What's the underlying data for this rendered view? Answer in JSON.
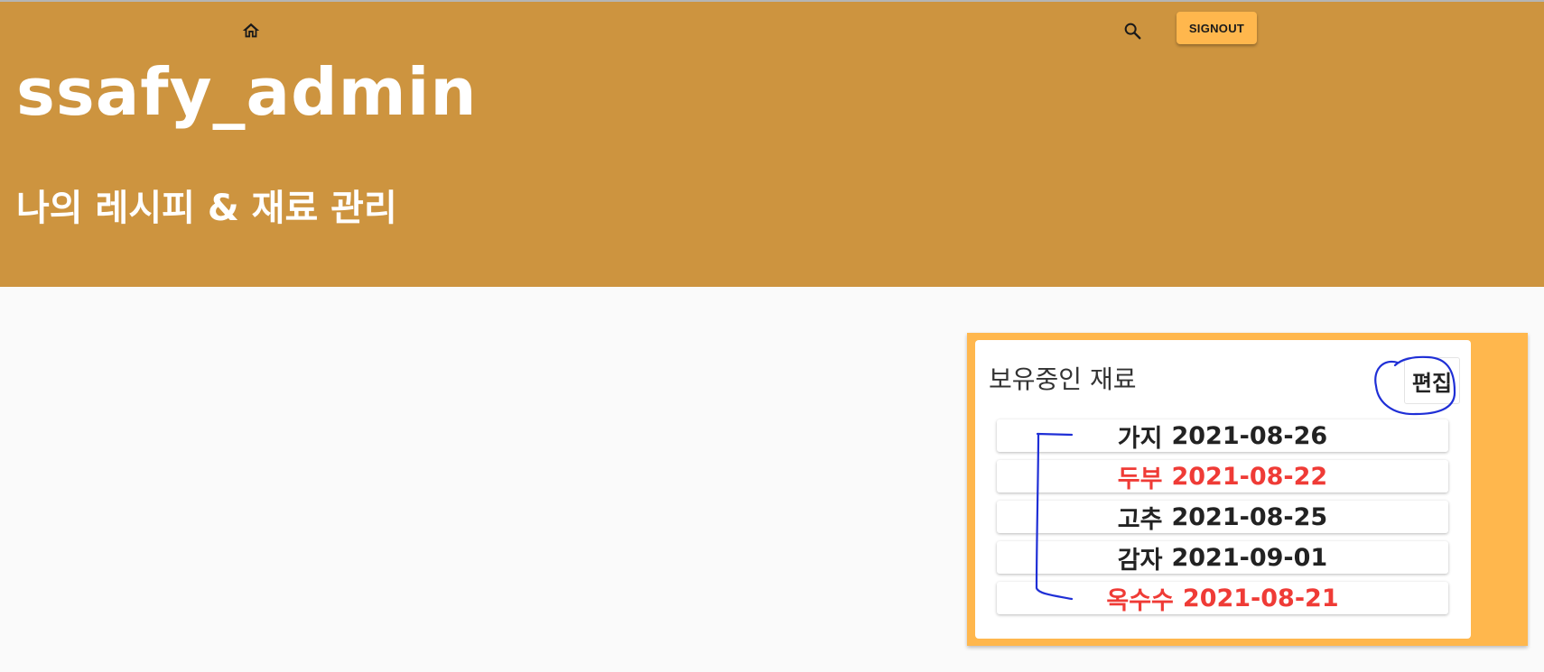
{
  "header": {
    "home_icon": "home-icon",
    "search_icon": "search-icon",
    "signout_label": "SIGNOUT",
    "title": "ssafy_admin",
    "subtitle": "나의 레시피 & 재료 관리",
    "background_color": "#cd943f"
  },
  "ingredients_panel": {
    "title": "보유중인 재료",
    "edit_label": "편집",
    "accent_color": "#ffb74d",
    "expired_color": "#ef3b36",
    "items": [
      {
        "name": "가지",
        "date": "2021-08-26",
        "expired": false
      },
      {
        "name": "두부",
        "date": "2021-08-22",
        "expired": true
      },
      {
        "name": "고추",
        "date": "2021-08-25",
        "expired": false
      },
      {
        "name": "감자",
        "date": "2021-09-01",
        "expired": false
      },
      {
        "name": "옥수수",
        "date": "2021-08-21",
        "expired": true
      }
    ]
  },
  "annotation": {
    "color": "#1f2fd6"
  }
}
